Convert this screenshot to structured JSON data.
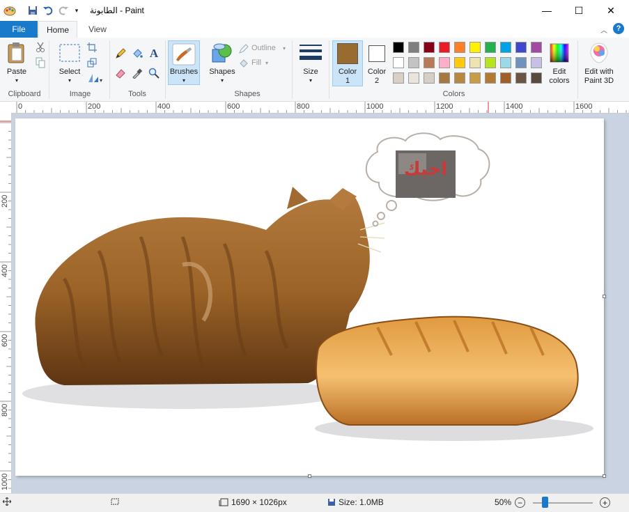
{
  "window": {
    "title": "الطابونة - Paint",
    "minimize_label": "—",
    "maximize_label": "☐",
    "close_label": "✕"
  },
  "tabs": {
    "file": "File",
    "home": "Home",
    "view": "View"
  },
  "ribbon": {
    "clipboard": {
      "paste": "Paste",
      "group": "Clipboard"
    },
    "image": {
      "select": "Select",
      "group": "Image"
    },
    "tools": {
      "group": "Tools"
    },
    "brushes": {
      "label": "Brushes"
    },
    "shapes": {
      "label": "Shapes",
      "outline": "Outline",
      "fill": "Fill",
      "group": "Shapes"
    },
    "size": {
      "label": "Size"
    },
    "color1": {
      "label": "Color",
      "num": "1",
      "value": "#996b2e"
    },
    "color2": {
      "label": "Color",
      "num": "2",
      "value": "#ffffff"
    },
    "colors_group": "Colors",
    "edit_colors": {
      "line1": "Edit",
      "line2": "colors"
    },
    "paint3d": {
      "line1": "Edit with",
      "line2": "Paint 3D"
    },
    "palette": [
      "#000000",
      "#7f7f7f",
      "#880015",
      "#ed1c24",
      "#ff7f27",
      "#fff200",
      "#22b14c",
      "#00a2e8",
      "#3f48cc",
      "#a349a4",
      "#ffffff",
      "#c3c3c3",
      "#b97a57",
      "#ffaec9",
      "#ffc90e",
      "#efe4b0",
      "#b5e61d",
      "#99d9ea",
      "#7092be",
      "#c8bfe7",
      "#d8d0c8",
      "#e9e4dc",
      "#d4cec6",
      "#a67a3e",
      "#b8873e",
      "#c89d45",
      "#b47a32",
      "#a25f25",
      "#6d5444",
      "#5a4a3e"
    ]
  },
  "rulers": {
    "h_labels": [
      "0",
      "200",
      "400",
      "600",
      "800",
      "1000",
      "1200",
      "1400",
      "1600"
    ],
    "v_labels": [
      "200",
      "400",
      "600",
      "800",
      "1000"
    ]
  },
  "canvas": {
    "thought_text": "احبك"
  },
  "status": {
    "dimensions": "1690 × 1026px",
    "size": "Size: 1.0MB",
    "zoom": "50%",
    "zoom_level": 0.5
  }
}
